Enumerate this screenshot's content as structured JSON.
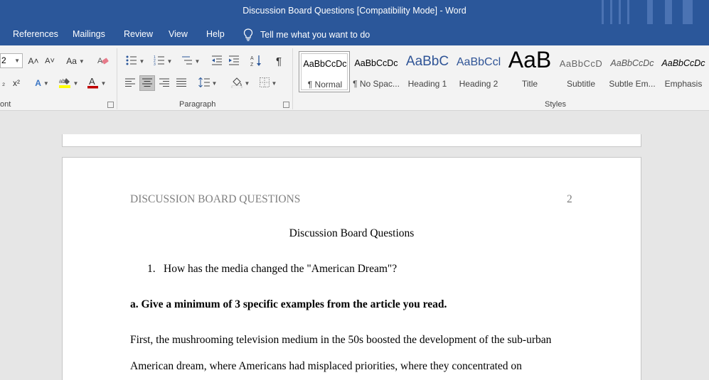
{
  "window": {
    "title": "Discussion Board Questions [Compatibility Mode]  -  Word"
  },
  "tabs": [
    {
      "label": "References"
    },
    {
      "label": "Mailings"
    },
    {
      "label": "Review"
    },
    {
      "label": "View"
    },
    {
      "label": "Help"
    }
  ],
  "tell_me": {
    "label": "Tell me what you want to do",
    "icon": "lightbulb-icon"
  },
  "font_group": {
    "label": "ont",
    "size_value": "2",
    "grow_label": "A˄",
    "shrink_label": "A˅",
    "case_label": "Aa",
    "subscript_label": "₂",
    "superscript_label": "x²",
    "font_color_hex": "#c00000",
    "highlight_hex": "#ffff00"
  },
  "paragraph_group": {
    "label": "Paragraph",
    "pilcrow": "¶",
    "sort_label": "A↓Z"
  },
  "styles_group": {
    "label": "Styles",
    "items": [
      {
        "sample": "AaBbCcDc",
        "name": "¶ Normal"
      },
      {
        "sample": "AaBbCcDc",
        "name": "¶ No Spac..."
      },
      {
        "sample": "AaBbC",
        "name": "Heading 1"
      },
      {
        "sample": "AaBbCcl",
        "name": "Heading 2"
      },
      {
        "sample": "AaB",
        "name": "Title"
      },
      {
        "sample": "AaBbCcD",
        "name": "Subtitle"
      },
      {
        "sample": "AaBbCcDc",
        "name": "Subtle Em..."
      },
      {
        "sample": "AaBbCcDc",
        "name": "Emphasis"
      }
    ]
  },
  "document": {
    "running_head": "DISCUSSION BOARD QUESTIONS",
    "page_number": "2",
    "title": "Discussion Board Questions",
    "list_number": "1.",
    "question": "How has the media changed the \"American Dream\"?",
    "sub_question": "a. Give a minimum of 3 specific examples from the article you read.",
    "body_lines": [
      "First, the mushrooming television medium in the 50s boosted the development of the sub-urban",
      "American dream, where Americans had misplaced priorities, where they concentrated on"
    ]
  },
  "colors": {
    "accent": "#2b579a",
    "heading_blue": "#2f5496"
  }
}
